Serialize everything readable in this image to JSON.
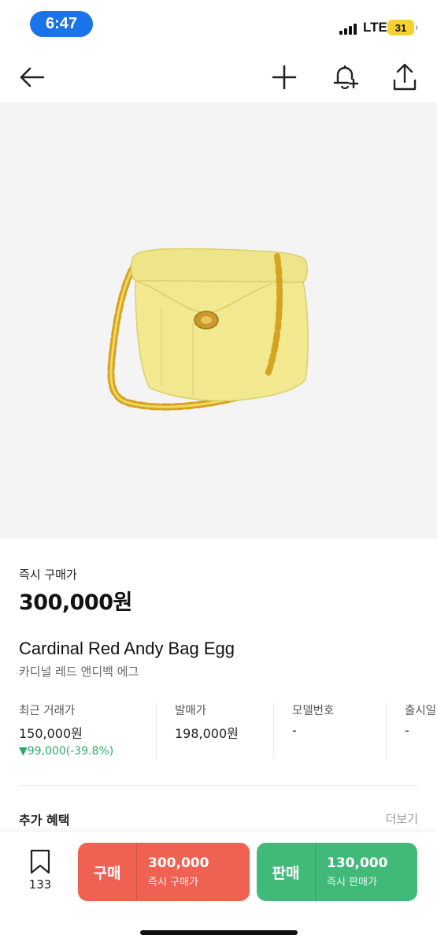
{
  "status": {
    "time": "6:47",
    "network": "LTE",
    "battery": "31"
  },
  "nav": {
    "back_icon": "back-arrow-icon",
    "add_icon": "plus-icon",
    "alert_icon": "bell-plus-icon",
    "share_icon": "share-icon"
  },
  "product": {
    "image_desc": "yellow-chain-bag",
    "instant_buy_label": "즉시 구매가",
    "price": "300,000원",
    "title_en": "Cardinal Red Andy Bag Egg",
    "title_ko": "카디널 레드 앤디백 에그"
  },
  "stats": [
    {
      "label": "최근 거래가",
      "value": "150,000원",
      "change": "▼99,000(-39.8%)"
    },
    {
      "label": "발매가",
      "value": "198,000원"
    },
    {
      "label": "모델번호",
      "value": "-"
    },
    {
      "label": "출시일",
      "value": "-"
    }
  ],
  "benefits": {
    "title": "추가 혜택",
    "more": "더보기"
  },
  "bottom": {
    "bookmark_count": "133",
    "buy": {
      "kind": "구매",
      "amount": "300,000",
      "sub": "즉시 구매가"
    },
    "sell": {
      "kind": "판매",
      "amount": "130,000",
      "sub": "즉시 판매가"
    }
  },
  "colors": {
    "buy": "#ef6253",
    "sell": "#41b979",
    "down": "#2da86b",
    "time_pill": "#1a73e8"
  }
}
